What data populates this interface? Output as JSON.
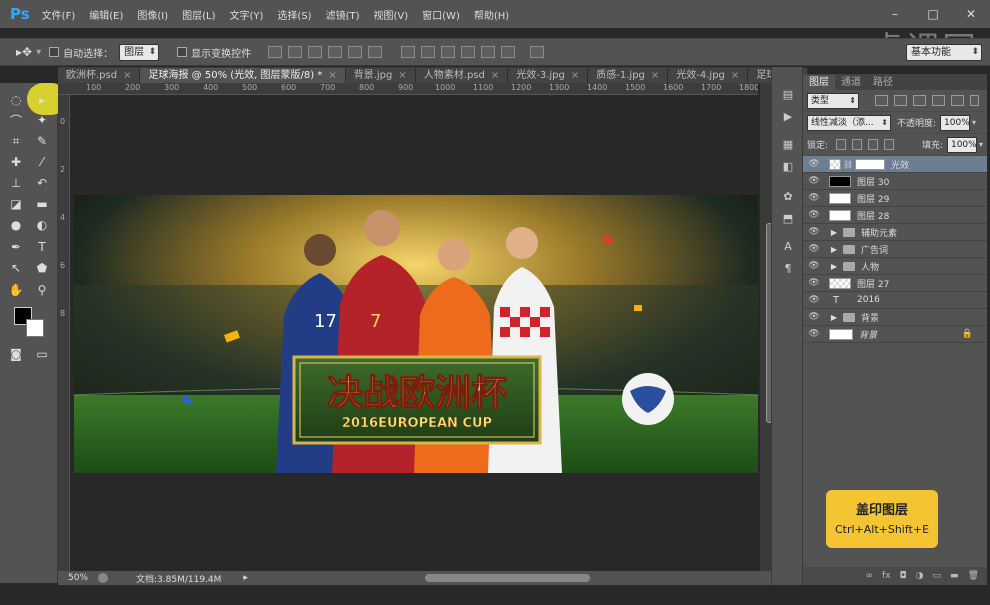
{
  "app": {
    "logo": "Ps",
    "watermark": "虎课网"
  },
  "menu": [
    "文件(F)",
    "编辑(E)",
    "图像(I)",
    "图层(L)",
    "文字(Y)",
    "选择(S)",
    "滤镜(T)",
    "视图(V)",
    "窗口(W)",
    "帮助(H)"
  ],
  "window_controls": [
    "–",
    "□",
    "✕"
  ],
  "options": {
    "auto_select_label": "自动选择：",
    "auto_select_value": "图层",
    "transform_label": "显示变换控件",
    "workspace": "基本功能"
  },
  "tabs": [
    "欧洲杯.psd",
    "足球海报 @ 50% (光效, 图层蒙版/8) *",
    "背景.jpg",
    "人物素材.psd",
    "光效-3.jpg",
    "质感-1.jpg",
    "光效-4.jpg",
    "足球.png"
  ],
  "ruler_marks": [
    "100",
    "200",
    "300",
    "400",
    "500",
    "600",
    "700",
    "800",
    "900",
    "1000",
    "1100",
    "1200",
    "1300",
    "1400",
    "1500",
    "1600",
    "1700",
    "1800"
  ],
  "ruler_v_marks": [
    "0",
    "2",
    "4",
    "6",
    "8"
  ],
  "status": {
    "zoom": "50%",
    "doc": "文档:3.85M/119.4M"
  },
  "banner": {
    "title": "决战欧洲杯",
    "subtitle": "2016EUROPEAN CUP",
    "jersey_17": "17",
    "jersey_7": "7"
  },
  "panel": {
    "tabs": [
      "图层",
      "通道",
      "路径"
    ],
    "filter_label": "类型",
    "blend_mode": "线性减淡（添...",
    "opacity_label": "不透明度:",
    "opacity_value": "100%",
    "lock_label": "锁定:",
    "fill_label": "填充:",
    "fill_value": "100%",
    "layers": [
      {
        "name": "光效",
        "type": "mask",
        "selected": true
      },
      {
        "name": "图层 30",
        "type": "black"
      },
      {
        "name": "图层 29",
        "type": "pixel"
      },
      {
        "name": "图层 28",
        "type": "pixel"
      },
      {
        "name": "辅助元素",
        "type": "folder"
      },
      {
        "name": "广告词",
        "type": "folder"
      },
      {
        "name": "人物",
        "type": "folder"
      },
      {
        "name": "图层 27",
        "type": "check"
      },
      {
        "name": "2016",
        "type": "text"
      },
      {
        "name": "背景",
        "type": "folder"
      },
      {
        "name": "背景",
        "type": "bg"
      }
    ],
    "bottom_icons": [
      "∞",
      "fx",
      "◘",
      "◑",
      "▭",
      "▬",
      "🗑"
    ]
  },
  "tooltip": {
    "title": "盖印图层",
    "shortcut": "Ctrl+Alt+Shift+E"
  },
  "colors": {
    "accent_layer": "#6d7d93",
    "tooltip_bg": "#f4c432",
    "ps_blue": "#31a8ff"
  }
}
